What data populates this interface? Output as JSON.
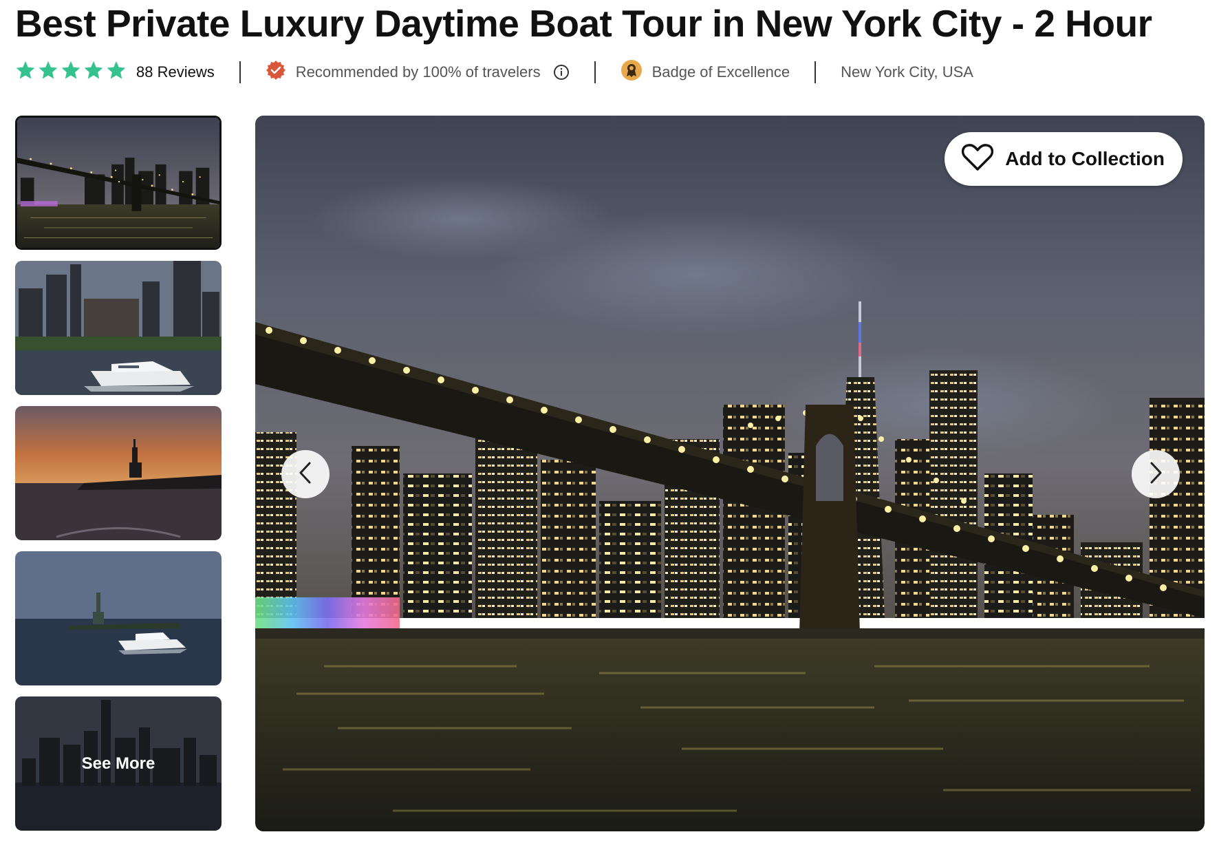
{
  "page": {
    "title": "Best Private Luxury Daytime Boat Tour in New York City - 2 Hour"
  },
  "meta": {
    "rating_stars": 5,
    "reviews_label": "88 Reviews",
    "recommended_label": "Recommended by 100% of travelers",
    "badge_label": "Badge of Excellence",
    "location_label": "New York City, USA"
  },
  "gallery": {
    "thumbnails": [
      {
        "name": "brooklyn-bridge-night"
      },
      {
        "name": "boat-manhattan-skyline"
      },
      {
        "name": "statue-of-liberty-sunset"
      },
      {
        "name": "statue-of-liberty-boat"
      },
      {
        "name": "lower-manhattan-skyline"
      }
    ],
    "see_more_label": "See More",
    "add_to_collection_label": "Add to Collection"
  },
  "colors": {
    "star_green": "#34C38F",
    "recommend_badge": "#D9573B",
    "excellence_badge": "#E8A84A"
  },
  "icons": [
    "star-icon",
    "recommended-badge-icon",
    "info-icon",
    "excellence-badge-icon",
    "heart-icon",
    "chevron-left-icon",
    "chevron-right-icon"
  ]
}
